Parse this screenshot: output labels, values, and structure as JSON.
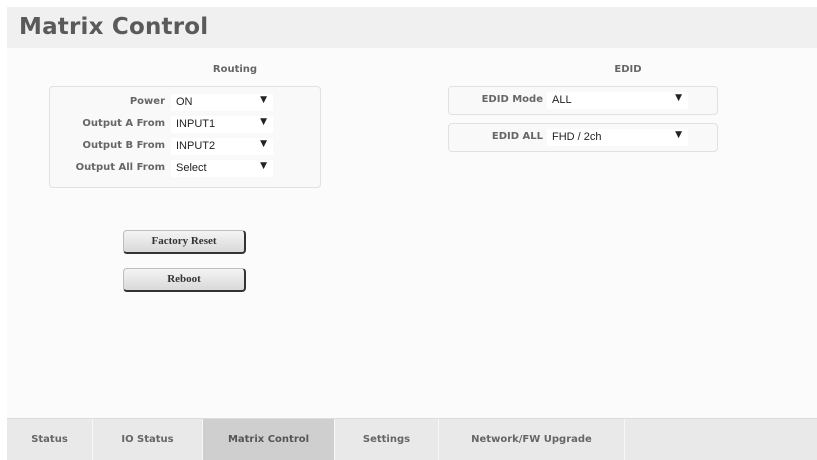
{
  "page": {
    "title": "Matrix Control"
  },
  "routing": {
    "heading": "Routing",
    "rows": [
      {
        "label": "Power",
        "value": "ON"
      },
      {
        "label": "Output A From",
        "value": "INPUT1"
      },
      {
        "label": "Output B From",
        "value": "INPUT2"
      },
      {
        "label": "Output All From",
        "value": "Select"
      }
    ],
    "factory_reset_label": "Factory Reset",
    "reboot_label": "Reboot"
  },
  "edid": {
    "heading": "EDID",
    "mode": {
      "label": "EDID Mode",
      "value": "ALL"
    },
    "all": {
      "label": "EDID ALL",
      "value": "FHD / 2ch"
    }
  },
  "tabs": [
    {
      "label": "Status",
      "active": false
    },
    {
      "label": "IO Status",
      "active": false
    },
    {
      "label": "Matrix Control",
      "active": true
    },
    {
      "label": "Settings",
      "active": false
    },
    {
      "label": "Network/FW Upgrade",
      "active": false
    }
  ],
  "icons": {
    "dropdown": "dropdown-arrow-icon"
  },
  "colors": {
    "active_tab": "#cfcfcf",
    "tab_bar": "#e9e9e9",
    "header": "#f0f0f0"
  }
}
